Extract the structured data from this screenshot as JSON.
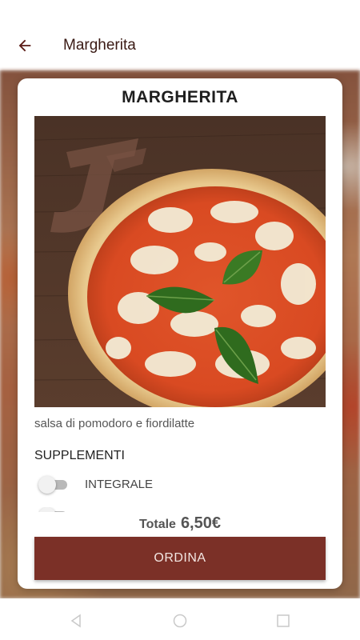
{
  "appbar": {
    "title": "Margherita",
    "back_icon": "arrow-left-icon"
  },
  "colors": {
    "accent": "#7b3027",
    "title_text": "#3a1a14"
  },
  "product": {
    "name": "MARGHERITA",
    "description": "salsa di pomodoro e fiordilatte",
    "image_icon": "pizza-photo"
  },
  "supplements": {
    "heading": "SUPPLEMENTI",
    "items": [
      {
        "label": "INTEGRALE",
        "enabled": false
      },
      {
        "label": "",
        "enabled": false
      }
    ]
  },
  "total": {
    "label": "Totale",
    "value": "6,50€"
  },
  "order_button": {
    "label": "ORDINA"
  },
  "navbar": {
    "back_icon": "nav-back-icon",
    "home_icon": "nav-home-icon",
    "recents_icon": "nav-recents-icon"
  }
}
